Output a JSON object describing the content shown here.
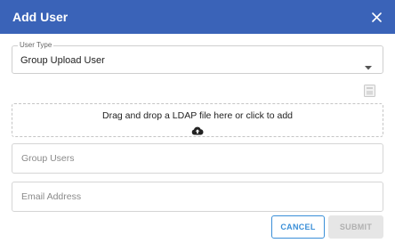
{
  "dialog": {
    "title": "Add User",
    "header_color": "#3a63b8"
  },
  "user_type": {
    "legend": "User Type",
    "selected": "Group Upload User"
  },
  "dropzone": {
    "text": "Drag and drop a LDAP file here or click to add",
    "icon": "cloud-upload-icon"
  },
  "fields": {
    "group_users_placeholder": "Group Users",
    "email_placeholder": "Email Address"
  },
  "actions": {
    "cancel_label": "CANCEL",
    "submit_label": "SUBMIT",
    "accent_color": "#3a8fd8"
  }
}
